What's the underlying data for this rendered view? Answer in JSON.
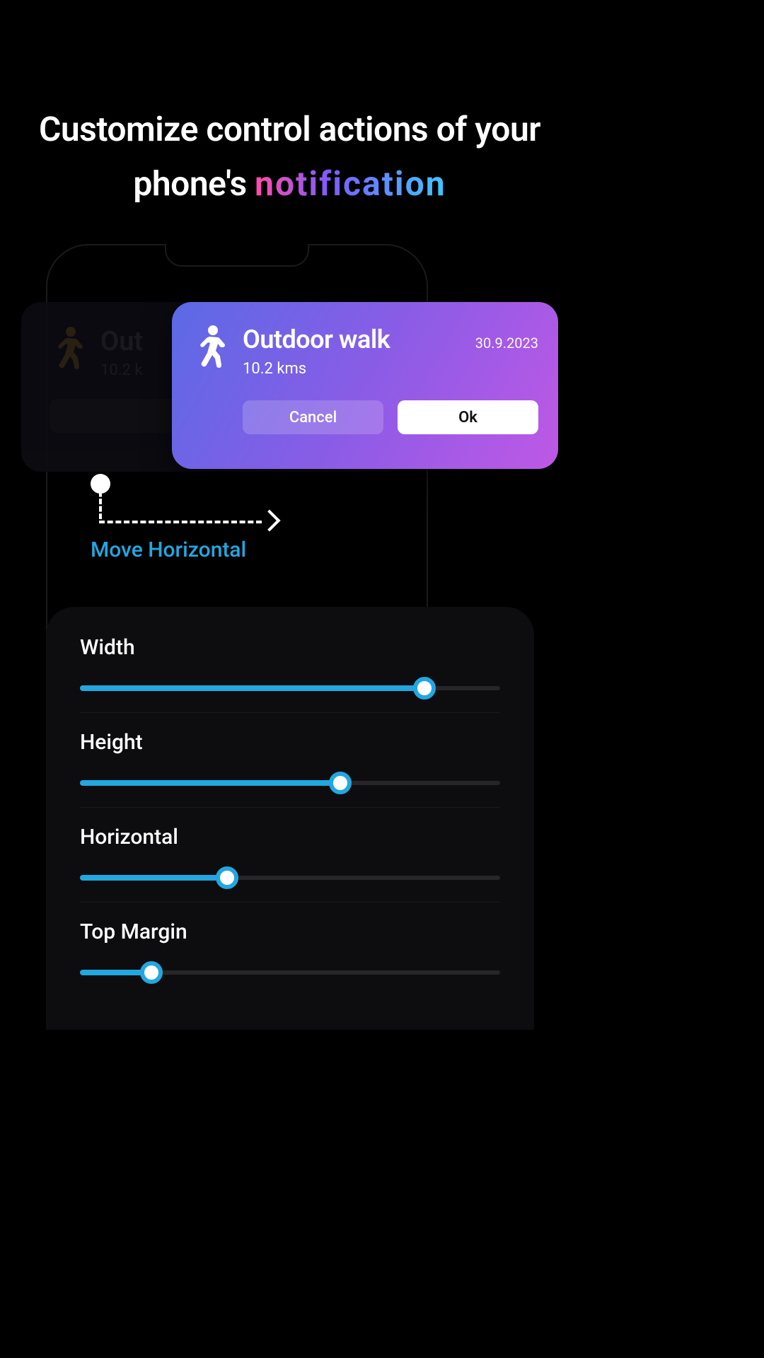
{
  "headline": {
    "line1": "Customize control actions of your",
    "line2_prefix": "phone's ",
    "line2_highlight": "notification"
  },
  "card_dim": {
    "title": "Out",
    "sub": "10.2 k",
    "btn1": "",
    "btn2": ""
  },
  "card_bright": {
    "title": "Outdoor walk",
    "date": "30.9.2023",
    "sub": "10.2 kms",
    "cancel": "Cancel",
    "ok": "Ok"
  },
  "move_hint": "Move Horizontal",
  "sliders": [
    {
      "label": "Width",
      "value": 82
    },
    {
      "label": "Height",
      "value": 62
    },
    {
      "label": "Horizontal",
      "value": 35
    },
    {
      "label": "Top Margin",
      "value": 17
    }
  ],
  "colors": {
    "accent": "#22a7e0"
  }
}
